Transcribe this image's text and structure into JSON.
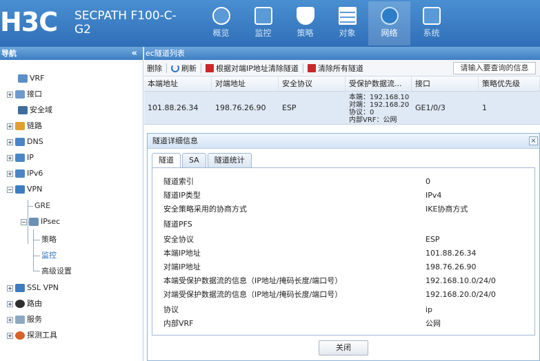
{
  "header": {
    "logo": "H3C",
    "product_line1": "SECPATH F100-C-",
    "product_line2": "G2",
    "nav": [
      {
        "label": "概览",
        "icon": "dashboard-icon"
      },
      {
        "label": "监控",
        "icon": "monitor-icon"
      },
      {
        "label": "策略",
        "icon": "shield-icon"
      },
      {
        "label": "对象",
        "icon": "object-stack-icon"
      },
      {
        "label": "网络",
        "icon": "globe-icon",
        "active": true
      },
      {
        "label": "系统",
        "icon": "system-code-icon"
      }
    ]
  },
  "sidebar": {
    "title": "导航",
    "collapse": "«",
    "items": [
      {
        "label": "VRF"
      },
      {
        "label": "接口"
      },
      {
        "label": "安全域"
      },
      {
        "label": "链路"
      },
      {
        "label": "DNS"
      },
      {
        "label": "IP"
      },
      {
        "label": "IPv6"
      },
      {
        "label": "VPN"
      },
      {
        "label": "GRE"
      },
      {
        "label": "IPsec"
      },
      {
        "label": "策略"
      },
      {
        "label": "监控"
      },
      {
        "label": "高级设置"
      },
      {
        "label": "SSL VPN"
      },
      {
        "label": "路由"
      },
      {
        "label": "服务"
      },
      {
        "label": "探测工具"
      }
    ]
  },
  "main": {
    "title": "ec隧道列表",
    "toolbar": {
      "delete": "删除",
      "refresh": "刷新",
      "clear_by_peer": "根据对端IP地址清除隧道",
      "clear_all": "清除所有隧道",
      "search": "请输入要查询的信息"
    },
    "table": {
      "headers": [
        "本端地址",
        "对端地址",
        "安全协议",
        "受保护数据流...",
        "接口",
        "策略优先级"
      ],
      "row": {
        "local": "101.88.26.34",
        "peer": "198.76.26.90",
        "protocol": "ESP",
        "flow_lines": [
          "本端：192.168.10",
          "对端：192.168.20",
          "协议：0",
          "内部VRF：公网"
        ],
        "interface": "GE1/0/3",
        "priority": "1"
      }
    }
  },
  "dialog": {
    "title": "隧道详细信息",
    "close_x": "×",
    "tabs": [
      "隧道",
      "SA",
      "隧道统计"
    ],
    "fields": [
      {
        "key": "隧道索引",
        "value": "0"
      },
      {
        "key": "隧道IP类型",
        "value": "IPv4"
      },
      {
        "key": "安全策略采用的协商方式",
        "value": "IKE协商方式"
      },
      {
        "key": "隧道PFS",
        "value": ""
      },
      {
        "key": "安全协议",
        "value": "ESP"
      },
      {
        "key": "本端IP地址",
        "value": "101.88.26.34"
      },
      {
        "key": "对端IP地址",
        "value": "198.76.26.90"
      },
      {
        "key": "本端受保护数据流的信息（IP地址/掩码长度/端口号）",
        "value": "192.168.10.0/24/0"
      },
      {
        "key": "对端受保护数据流的信息（IP地址/掩码长度/端口号）",
        "value": "192.168.20.0/24/0"
      },
      {
        "key": "协议",
        "value": "ip"
      },
      {
        "key": "内部VRF",
        "value": "公网"
      }
    ],
    "close_button": "关闭"
  },
  "colors": {
    "header_blue": "#2f6fb8",
    "panel_blue": "#3d7fc3",
    "row_selected": "#dfe9f5",
    "link_selected": "#2a6fc0"
  }
}
